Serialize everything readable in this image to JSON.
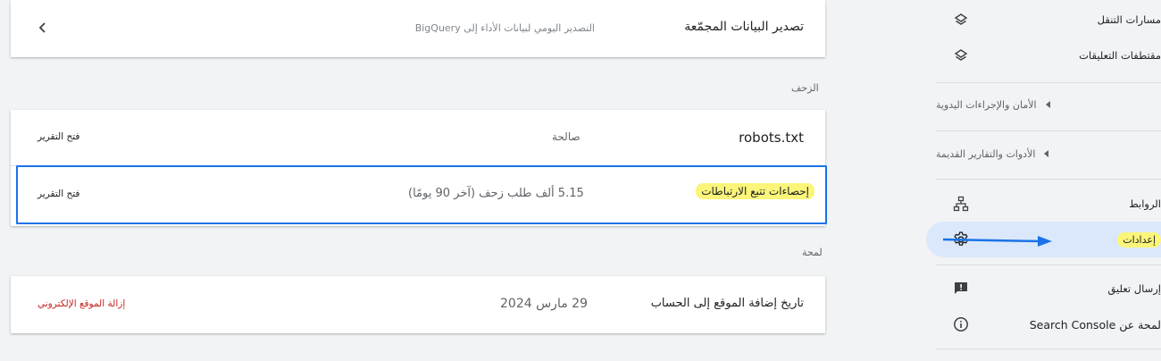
{
  "sidebar": {
    "items_top": [
      {
        "label": "مسارات التنقل",
        "icon": "layers-icon"
      },
      {
        "label": "مقتطفات التعليقات",
        "icon": "layers-icon"
      }
    ],
    "groups": [
      {
        "label": "الأمان والإجراءات اليدوية"
      },
      {
        "label": "الأدوات والتقارير القديمة"
      }
    ],
    "links_label": "الروابط",
    "settings_label": "إعدادات",
    "feedback_label": "إرسال تعليق",
    "about_label": "لمحة عن Search Console"
  },
  "bulk_export": {
    "title": "تصدير البيانات المجمّعة",
    "description": "التصدير اليومي لبيانات الأداء إلى BigQuery"
  },
  "crawl": {
    "section_title": "الزحف",
    "rows": [
      {
        "title": "robots.txt",
        "status": "صالحة",
        "action": "فتح التقرير"
      },
      {
        "title": "إحصاءات تتبع الارتباطات",
        "status": "5.15 ألف طلب زحف (آخر 90 يومًا)",
        "action": "فتح التقرير"
      }
    ]
  },
  "about": {
    "section_title": "لمحة",
    "row": {
      "title": "تاريخ إضافة الموقع إلى الحساب",
      "date": "29 مارس 2024",
      "action": "إزالة الموقع الإلكتروني"
    }
  },
  "colors": {
    "accent": "#1a73e8",
    "highlight": "#fbf57a",
    "danger": "#c5221f",
    "active_bg": "#dbe8fb"
  }
}
